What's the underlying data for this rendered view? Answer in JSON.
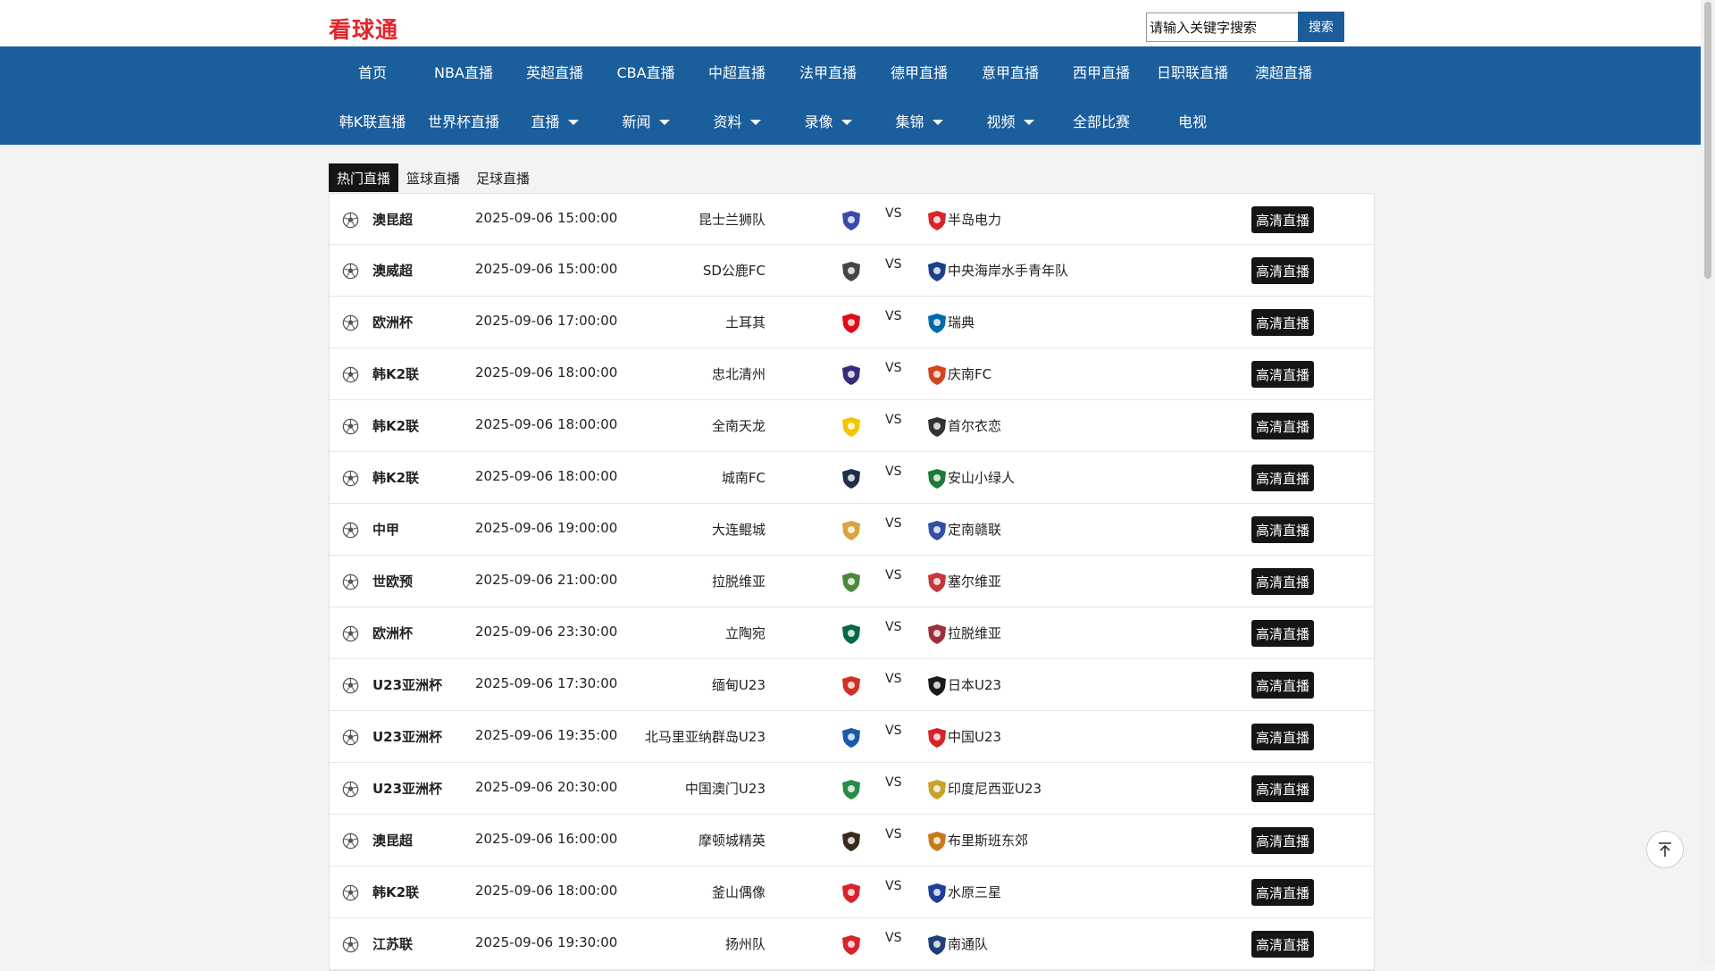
{
  "site": {
    "title": "看球通"
  },
  "search": {
    "placeholder": "请输入关键字搜索",
    "button_label": "搜索"
  },
  "nav": {
    "row1": [
      {
        "label": "首页"
      },
      {
        "label": "NBA直播"
      },
      {
        "label": "英超直播"
      },
      {
        "label": "CBA直播"
      },
      {
        "label": "中超直播"
      },
      {
        "label": "法甲直播"
      },
      {
        "label": "德甲直播"
      },
      {
        "label": "意甲直播"
      },
      {
        "label": "西甲直播"
      },
      {
        "label": "日职联直播"
      },
      {
        "label": "澳超直播"
      }
    ],
    "row2": [
      {
        "label": "韩K联直播",
        "dropdown": false
      },
      {
        "label": "世界杯直播",
        "dropdown": false
      },
      {
        "label": "直播",
        "dropdown": true
      },
      {
        "label": "新闻",
        "dropdown": true
      },
      {
        "label": "资料",
        "dropdown": true
      },
      {
        "label": "录像",
        "dropdown": true
      },
      {
        "label": "集锦",
        "dropdown": true
      },
      {
        "label": "视频",
        "dropdown": true
      },
      {
        "label": "全部比赛",
        "dropdown": false
      },
      {
        "label": "电视",
        "dropdown": false
      }
    ]
  },
  "tabs": [
    {
      "label": "热门直播",
      "active": true
    },
    {
      "label": "篮球直播",
      "active": false
    },
    {
      "label": "足球直播",
      "active": false
    }
  ],
  "vs_label": "VS",
  "matches": [
    {
      "league": "澳昆超",
      "time": "2025-09-06 15:00:00",
      "home": "昆士兰狮队",
      "away": "半岛电力",
      "button": "高清直播",
      "home_color": "#3b4aa8",
      "away_color": "#d8232a"
    },
    {
      "league": "澳威超",
      "time": "2025-09-06 15:00:00",
      "home": "SD公鹿FC",
      "away": "中央海岸水手青年队",
      "button": "高清直播",
      "home_color": "#444444",
      "away_color": "#1b3f8a"
    },
    {
      "league": "欧洲杯",
      "time": "2025-09-06 17:00:00",
      "home": "土耳其",
      "away": "瑞典",
      "button": "高清直播",
      "home_color": "#e30a17",
      "away_color": "#006aa7"
    },
    {
      "league": "韩K2联",
      "time": "2025-09-06 18:00:00",
      "home": "忠北清州",
      "away": "庆南FC",
      "button": "高清直播",
      "home_color": "#3a2a7a",
      "away_color": "#d2461e"
    },
    {
      "league": "韩K2联",
      "time": "2025-09-06 18:00:00",
      "home": "全南天龙",
      "away": "首尔衣恋",
      "button": "高清直播",
      "home_color": "#f5c400",
      "away_color": "#333333"
    },
    {
      "league": "韩K2联",
      "time": "2025-09-06 18:00:00",
      "home": "城南FC",
      "away": "安山小绿人",
      "button": "高清直播",
      "home_color": "#1f2f4a",
      "away_color": "#1f7a3a"
    },
    {
      "league": "中甲",
      "time": "2025-09-06 19:00:00",
      "home": "大连鲲城",
      "away": "定南赣联",
      "button": "高清直播",
      "home_color": "#d9a441",
      "away_color": "#2f4fa8"
    },
    {
      "league": "世欧预",
      "time": "2025-09-06 21:00:00",
      "home": "拉脱维亚",
      "away": "塞尔维亚",
      "button": "高清直播",
      "home_color": "#4a8a3a",
      "away_color": "#c6363c"
    },
    {
      "league": "欧洲杯",
      "time": "2025-09-06 23:30:00",
      "home": "立陶宛",
      "away": "拉脱维亚",
      "button": "高清直播",
      "home_color": "#006a44",
      "away_color": "#9e3039"
    },
    {
      "league": "U23亚洲杯",
      "time": "2025-09-06 17:30:00",
      "home": "缅甸U23",
      "away": "日本U23",
      "button": "高清直播",
      "home_color": "#d22f27",
      "away_color": "#1a1a1a"
    },
    {
      "league": "U23亚洲杯",
      "time": "2025-09-06 19:35:00",
      "home": "北马里亚纳群岛U23",
      "away": "中国U23",
      "button": "高清直播",
      "home_color": "#1a5aa8",
      "away_color": "#d8232a"
    },
    {
      "league": "U23亚洲杯",
      "time": "2025-09-06 20:30:00",
      "home": "中国澳门U23",
      "away": "印度尼西亚U23",
      "button": "高清直播",
      "home_color": "#2a8a4a",
      "away_color": "#c9a227"
    },
    {
      "league": "澳昆超",
      "time": "2025-09-06 16:00:00",
      "home": "摩顿城精英",
      "away": "布里斯班东郊",
      "button": "高清直播",
      "home_color": "#3a2a1a",
      "away_color": "#c77a1a"
    },
    {
      "league": "韩K2联",
      "time": "2025-09-06 18:00:00",
      "home": "釜山偶像",
      "away": "水原三星",
      "button": "高清直播",
      "home_color": "#d8232a",
      "away_color": "#1d3f9a"
    },
    {
      "league": "江苏联",
      "time": "2025-09-06 19:30:00",
      "home": "扬州队",
      "away": "南通队",
      "button": "高清直播",
      "home_color": "#d8232a",
      "away_color": "#1d3f7a"
    }
  ]
}
